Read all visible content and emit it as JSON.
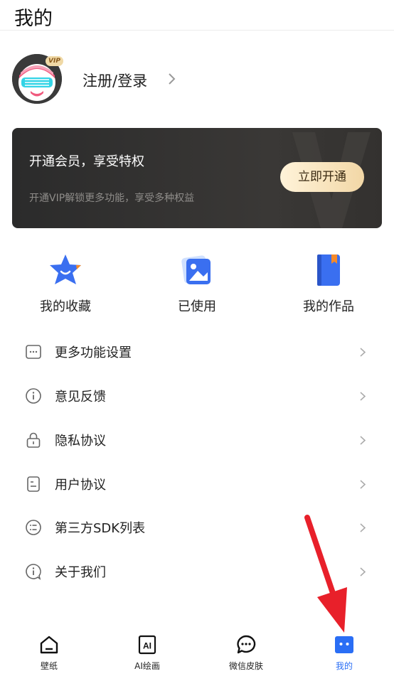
{
  "header": {
    "title": "我的"
  },
  "profile": {
    "vip_badge": "VIP",
    "login_label": "注册/登录"
  },
  "vip_card": {
    "title": "开通会员，享受特权",
    "subtitle": "开通VIP解锁更多功能，享受多种权益",
    "button_label": "立即开通"
  },
  "quick_actions": [
    {
      "label": "我的收藏",
      "icon": "star-icon"
    },
    {
      "label": "已使用",
      "icon": "image-icon"
    },
    {
      "label": "我的作品",
      "icon": "book-icon"
    }
  ],
  "menu": [
    {
      "label": "更多功能设置",
      "icon": "more-settings-icon"
    },
    {
      "label": "意见反馈",
      "icon": "info-icon"
    },
    {
      "label": "隐私协议",
      "icon": "lock-icon"
    },
    {
      "label": "用户协议",
      "icon": "document-icon"
    },
    {
      "label": "第三方SDK列表",
      "icon": "list-icon"
    },
    {
      "label": "关于我们",
      "icon": "about-icon"
    }
  ],
  "tabs": [
    {
      "label": "壁纸",
      "icon": "home-icon"
    },
    {
      "label": "AI绘画",
      "icon": "ai-icon"
    },
    {
      "label": "微信皮肤",
      "icon": "chat-icon"
    },
    {
      "label": "我的",
      "icon": "profile-icon",
      "active": true
    }
  ],
  "colors": {
    "accent": "#2a6ef5",
    "vip_card_bg": "#2b2b2b",
    "vip_button": "#f2d7a6",
    "annotation_arrow": "#e8202a"
  }
}
